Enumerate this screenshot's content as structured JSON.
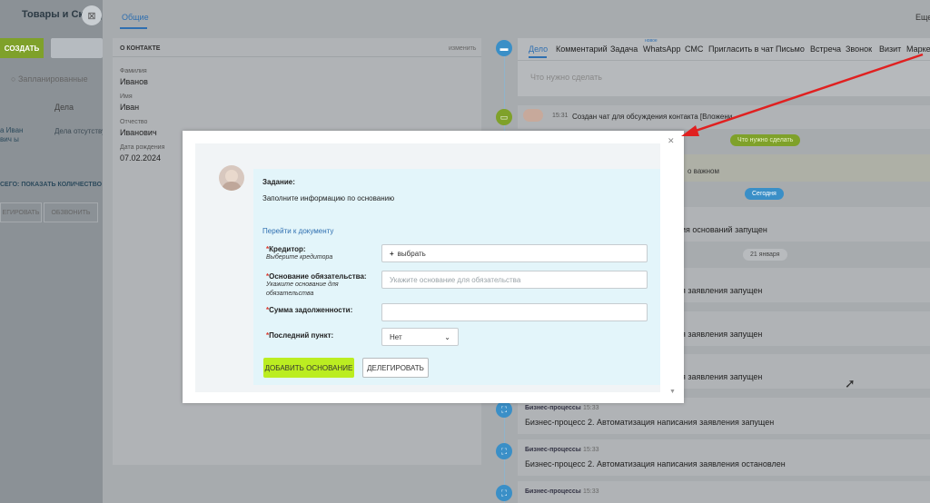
{
  "left_panel": {
    "title": "Товары и Склад",
    "close_icon": "close-icon",
    "create_label": "СОЗДАТЬ",
    "filter_label": "Запланированные",
    "column_header": "Дела",
    "row_name": "а Иван вич ы",
    "row_cell": "Дела отсутству",
    "count_label": "СЕГО: ПОКАЗАТЬ КОЛИЧЕСТВО",
    "btn_delegate": "ЕГИРОВАТЬ",
    "btn_call": "ОБЗВОНИТЬ"
  },
  "header": {
    "active_tab": "Общие",
    "more_label": "Еще"
  },
  "contact_card": {
    "title": "О КОНТАКТЕ",
    "edit_label": "изменить",
    "fields": [
      {
        "label": "Фамилия",
        "value": "Иванов"
      },
      {
        "label": "Имя",
        "value": "Иван"
      },
      {
        "label": "Отчество",
        "value": "Иванович"
      },
      {
        "label": "Дата рождения",
        "value": "07.02.2024"
      }
    ]
  },
  "composer": {
    "tabs": [
      "Дело",
      "Комментарий",
      "Задача",
      "WhatsApp",
      "СМС",
      "Пригласить в чат",
      "Письмо",
      "Встреча",
      "Звонок",
      "Визит",
      "Марке"
    ],
    "new_badge": "новое",
    "placeholder": "Что нужно сделать"
  },
  "timeline": {
    "chat_time": "15:31",
    "chat_text": "Создан чат для обсуждения контакта [Вложени",
    "todo_pill": "Что нужно сделать",
    "important_text": "о важном",
    "today_pill": "Сегодня",
    "bp_partial_1": "ния оснований запущен",
    "date_pill": "21 января",
    "bp_partial_2": "ия заявления запущен",
    "bp_partial_3": "ия заявления запущен",
    "bp_partial_4": "ия заявления запущен",
    "bp_items": [
      {
        "title": "Бизнес-процессы",
        "time": "15:33",
        "text": "Бизнес-процесс 2. Автоматизация написания заявления запущен"
      },
      {
        "title": "Бизнес-процессы",
        "time": "15:33",
        "text": "Бизнес-процесс 2. Автоматизация написания заявления остановлен"
      },
      {
        "title": "Бизнес-процессы",
        "time": "15:33",
        "text": ""
      }
    ]
  },
  "modal": {
    "task_label": "Задание:",
    "task_text": "Заполните информацию по основанию",
    "doc_link": "Перейти к документу",
    "creditor_label": "Кредитор:",
    "creditor_hint": "Выберите кредитора",
    "creditor_button": "выбрать",
    "basis_label": "Основание обязательства:",
    "basis_hint": "Укажите основание для обязательства",
    "basis_placeholder": "Укажите основание для обязательства",
    "debt_label": "Сумма задолженности:",
    "debt_value": "",
    "last_label": "Последний пункт:",
    "last_value": "Нет",
    "add_button": "ДОБАВИТЬ ОСНОВАНИЕ",
    "delegate_button": "ДЕЛЕГИРОВАТЬ",
    "required_mark": "*"
  },
  "colors": {
    "accent": "#2f6fb0",
    "green_button": "#bbed21",
    "arrow": "#e02020",
    "required": "#d9382f"
  }
}
